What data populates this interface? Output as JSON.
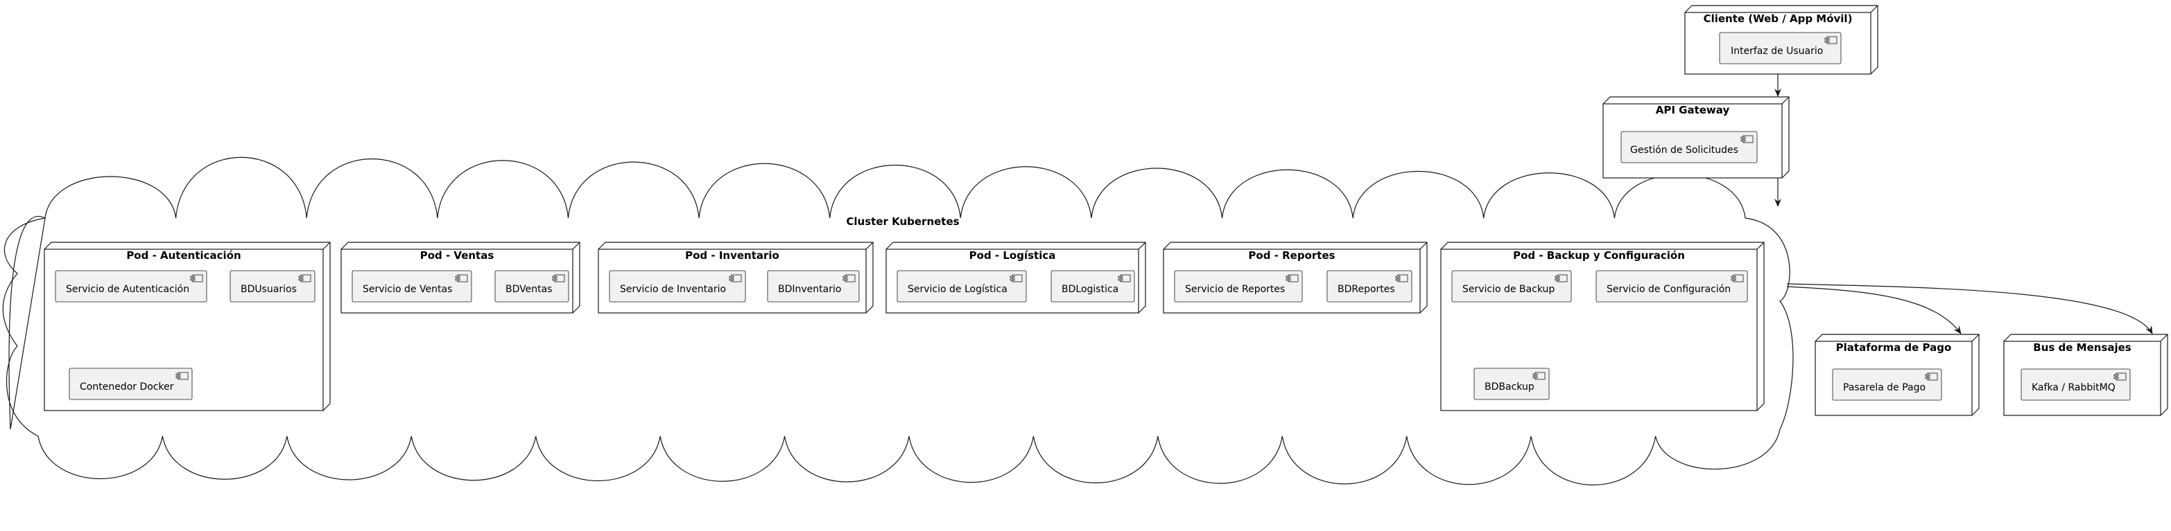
{
  "diagram": {
    "cloud": {
      "title": "Cluster Kubernetes"
    },
    "nodes": {
      "cliente": {
        "title": "Cliente (Web / App Móvil)",
        "components": [
          "Interfaz de Usuario"
        ]
      },
      "api": {
        "title": "API Gateway",
        "components": [
          "Gestión de Solicitudes"
        ]
      },
      "auth": {
        "title": "Pod - Autenticación",
        "components": [
          "Servicio de Autenticación",
          "BDUsuarios",
          "Contenedor Docker"
        ]
      },
      "ventas": {
        "title": "Pod - Ventas",
        "components": [
          "Servicio de Ventas",
          "BDVentas"
        ]
      },
      "inventario": {
        "title": "Pod - Inventario",
        "components": [
          "Servicio de Inventario",
          "BDInventario"
        ]
      },
      "logistica": {
        "title": "Pod - Logística",
        "components": [
          "Servicio de Logística",
          "BDLogistica"
        ]
      },
      "reportes": {
        "title": "Pod - Reportes",
        "components": [
          "Servicio de Reportes",
          "BDReportes"
        ]
      },
      "backup": {
        "title": "Pod - Backup y Configuración",
        "components": [
          "Servicio de Backup",
          "Servicio de Configuración",
          "BDBackup"
        ]
      },
      "pago": {
        "title": "Plataforma de Pago",
        "components": [
          "Pasarela de Pago"
        ]
      },
      "bus": {
        "title": "Bus de Mensajes",
        "components": [
          "Kafka / RabbitMQ"
        ]
      }
    },
    "colors": {
      "component_fill": "#f1f1f1",
      "stroke": "#181818",
      "background": "#ffffff"
    }
  }
}
